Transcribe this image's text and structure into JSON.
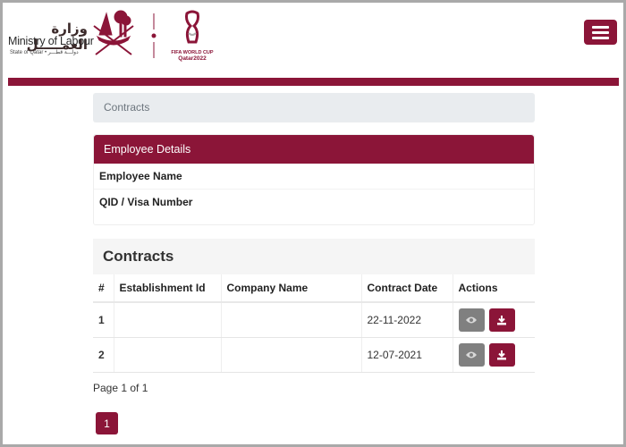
{
  "header": {
    "ministry_arabic": "وزارة العمـــــل",
    "ministry_english": "Ministry of Labour",
    "ministry_sub": "State of Qatar • دولـــة قطـــر",
    "world_cup_line1": "FIFA WORLD CUP",
    "world_cup_line2": "Qatar2022",
    "menu_icon": "hamburger-menu-icon"
  },
  "colors": {
    "brand": "#8b1538",
    "view_button": "#808080",
    "breadcrumb_bg": "#e9ecef"
  },
  "breadcrumb": {
    "current": "Contracts"
  },
  "employee_card": {
    "title": "Employee Details",
    "rows": [
      {
        "label": "Employee Name"
      },
      {
        "label": "QID / Visa Number"
      }
    ]
  },
  "contracts": {
    "title": "Contracts",
    "columns": [
      "#",
      "Establishment Id",
      "Company Name",
      "Contract Date",
      "Actions"
    ],
    "rows": [
      {
        "index": "1",
        "establishment_id": "",
        "company_name": "",
        "contract_date": "22-11-2022",
        "actions": [
          "eye-icon",
          "download-icon"
        ]
      },
      {
        "index": "2",
        "establishment_id": "",
        "company_name": "",
        "contract_date": "12-07-2021",
        "actions": [
          "eye-icon",
          "download-icon"
        ]
      }
    ]
  },
  "pagination": {
    "summary": "Page 1 of 1",
    "pages": [
      "1"
    ],
    "current": "1"
  }
}
